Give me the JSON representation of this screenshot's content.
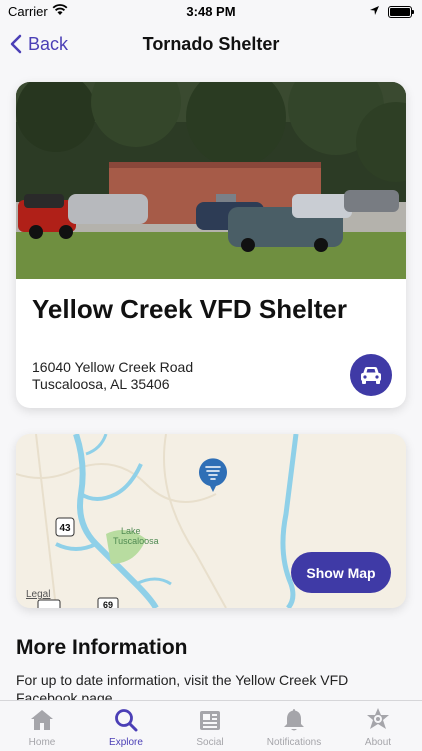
{
  "status_bar": {
    "carrier": "Carrier",
    "time": "3:48 PM"
  },
  "nav": {
    "back_label": "Back",
    "title": "Tornado Shelter"
  },
  "shelter": {
    "name": "Yellow Creek VFD Shelter",
    "address_line1": "16040 Yellow Creek Road",
    "address_line2": "Tuscaloosa, AL 35406"
  },
  "map": {
    "lake_label_1": "Lake",
    "lake_label_2": "Tuscaloosa",
    "route_43": "43",
    "route_69": "69",
    "legal": "Legal",
    "show_map_label": "Show Map"
  },
  "more_info": {
    "title": "More Information",
    "text": "For up to date information, visit the Yellow Creek VFD Facebook page."
  },
  "tabs": [
    {
      "label": "Home",
      "icon": "home-icon"
    },
    {
      "label": "Explore",
      "icon": "search-icon"
    },
    {
      "label": "Social",
      "icon": "newspaper-icon"
    },
    {
      "label": "Notifications",
      "icon": "bell-icon"
    },
    {
      "label": "About",
      "icon": "badge-icon"
    }
  ],
  "active_tab": "Explore",
  "colors": {
    "accent": "#3f3aa6",
    "tab_inactive": "#a5a5aa"
  }
}
